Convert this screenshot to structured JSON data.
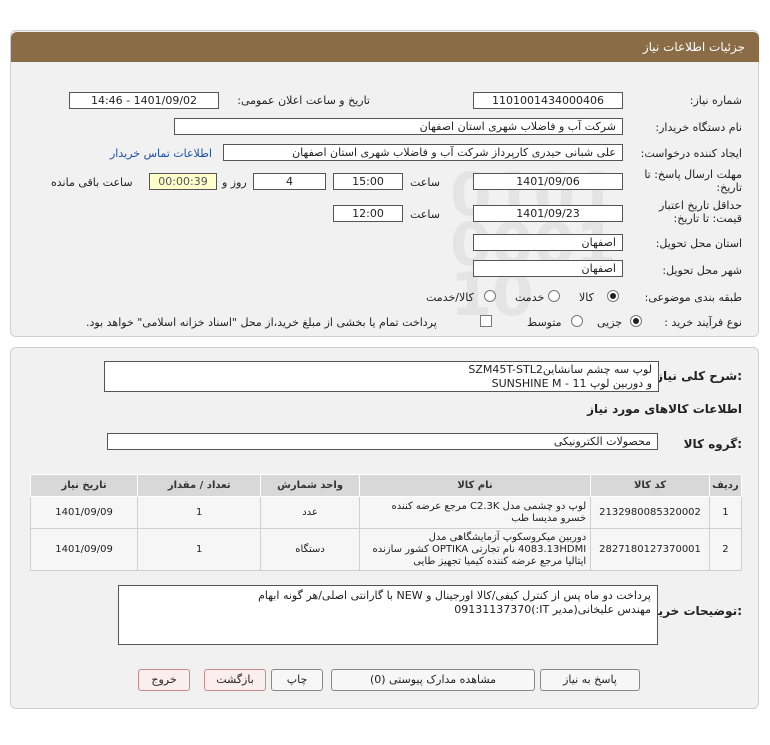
{
  "window": {
    "title": "جزئیات اطلاعات نیاز"
  },
  "form": {
    "need_number_label": "شماره نیاز:",
    "need_number": "1101001434000406",
    "announce_label": "تاریخ و ساعت اعلان عمومی:",
    "announce_value": "1401/09/02 - 14:46",
    "buyer_org_label": "نام دستگاه خریدار:",
    "buyer_org": "شرکت آب و فاضلاب شهری استان اصفهان",
    "creator_label": "ایجاد کننده درخواست:",
    "creator": "علی شبانی حیدری کارپرداز شرکت آب و فاضلاب شهری استان اصفهان",
    "contact_link": "اطلاعات تماس خریدار",
    "deadline_label_1": "مهلت ارسال پاسخ: تا",
    "deadline_label_2": "تاریخ:",
    "deadline_date": "1401/09/06",
    "time_label": "ساعت",
    "deadline_time": "15:00",
    "days_value": "4",
    "days_label": "روز و",
    "remaining_time": "00:00:39",
    "remaining_label": "ساعت باقی مانده",
    "validity_label_1": "حداقل تاریخ اعتبار",
    "validity_label_2": "قیمت: تا تاریخ:",
    "validity_date": "1401/09/23",
    "validity_time": "12:00",
    "province_label": "استان محل تحویل:",
    "province": "اصفهان",
    "city_label": "شهر محل تحویل:",
    "city": "اصفهان",
    "category_label": "طبقه بندی موضوعی:",
    "category_options": [
      "کالا",
      "خدمت",
      "کالا/خدمت"
    ],
    "process_label": "نوع فرآیند خرید :",
    "process_options": [
      "جزیی",
      "متوسط"
    ],
    "treasury_note": "پرداخت تمام یا بخشی از مبلغ خرید،از محل \"اسناد خزانه اسلامی\" خواهد بود."
  },
  "details": {
    "summary_label": "شرح کلی نیاز:",
    "summary_line1": "لوپ سه چشم سانشاینSZM45T-STL2",
    "summary_line2": "و دوربین لوپ 11  - SUNSHINE M",
    "goods_info_title": "اطلاعات کالاهای مورد نیاز",
    "group_label": "گروه کالا:",
    "group_value": "محصولات الکترونیکی"
  },
  "table": {
    "headers": [
      "ردیف",
      "کد کالا",
      "نام کالا",
      "واحد شمارش",
      "تعداد / مقدار",
      "تاریخ نیاز"
    ],
    "rows": [
      {
        "row": "1",
        "code": "2132980085320002",
        "name": "لوپ دو چشمی مدل C2.3K مرجع عرضه کننده خسرو مدیسا طب",
        "unit": "عدد",
        "qty": "1",
        "date": "1401/09/09"
      },
      {
        "row": "2",
        "code": "2827180127370001",
        "name": "دوربین میکروسکوپ آزمایشگاهی مدل 4083.13HDMI نام تجارتی OPTIKA کشور سازنده ایتالیا مرجع عرضه کننده کیمیا تجهیز طایی",
        "unit": "دستگاه",
        "qty": "1",
        "date": "1401/09/09"
      }
    ]
  },
  "buyer_notes": {
    "label": "توضیحات خریدار:",
    "line1": "پرداخت دو ماه پس از کنترل کیفی/کالا اورجینال و NEW با گارانتی اصلی/هر گونه ابهام",
    "line2": "مهندس علیخانی(مدیر IT:)09131137370"
  },
  "buttons": {
    "reply": "پاسخ به نیاز",
    "attachments": "مشاهده مدارک پیوستی (0)",
    "print": "چاپ",
    "back": "بازگشت",
    "exit": "خروج"
  },
  "watermark": {
    "brand": "ParsNamadData"
  },
  "colors": {
    "title_bar": "#8a6d47",
    "link": "#1a4fa8",
    "remaining_bg": "#ffffcc"
  }
}
